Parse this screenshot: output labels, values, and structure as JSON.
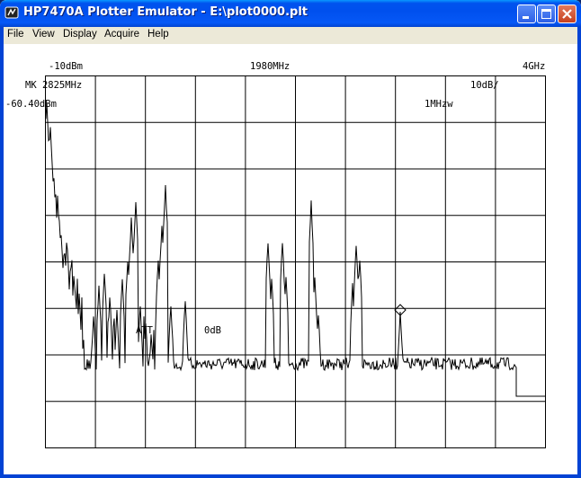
{
  "window": {
    "title": "HP7470A Plotter Emulator - E:\\plot0000.plt",
    "app_icon": "plotter-icon",
    "controls": {
      "minimize": "minimize-icon",
      "maximize": "maximize-icon",
      "close": "close-icon"
    }
  },
  "menu": [
    "File",
    "View",
    "Display",
    "Acquire",
    "Help"
  ],
  "plot": {
    "ref_level": "-10dBm",
    "center_freq": "1980MHz",
    "stop_freq": "4GHz",
    "marker_freq": "MK 2825MHz",
    "scale": "10dB/",
    "marker_level": "-60.40dBm",
    "rbw": "1MHzw",
    "att_label": "ATT",
    "att_value": "0dB"
  },
  "colors": {
    "titlebar": "#0053ee",
    "frame": "#0343d4",
    "plot_bg": "#ffffff",
    "ink": "#000000"
  }
}
